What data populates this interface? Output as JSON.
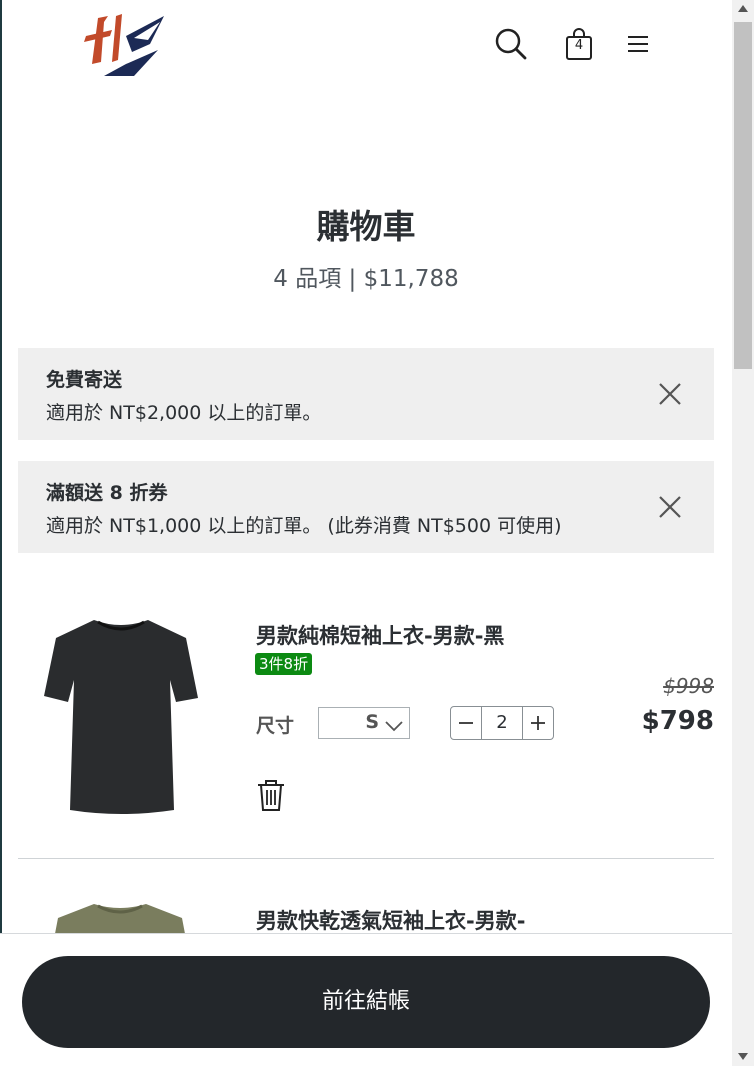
{
  "header": {
    "logo_name": "brand-logo",
    "cart_count": "4"
  },
  "cart": {
    "title": "購物車",
    "summary": "4 品項 |  $11,788"
  },
  "promos": [
    {
      "title": "免費寄送",
      "description": "適用於 NT$2,000 以上的訂單。"
    },
    {
      "title": "滿額送 8 折券",
      "description": "適用於 NT$1,000 以上的訂單。 (此券消費 NT$500 可使用)"
    }
  ],
  "items": [
    {
      "name": "男款純棉短袖上衣-男款-黑",
      "badge": "3件8折",
      "size_label": "尺寸",
      "size": "S",
      "quantity": "2",
      "original_price": "$998",
      "price": "$798",
      "color": "#2a2c2e"
    },
    {
      "name": "男款快乾透氣短袖上衣-男款-",
      "color": "#7a7d5e"
    }
  ],
  "checkout": {
    "label": "前往結帳"
  },
  "colors": {
    "accent_dark": "#23272b",
    "badge_green": "#0c8a12",
    "promo_bg": "#efefef"
  }
}
